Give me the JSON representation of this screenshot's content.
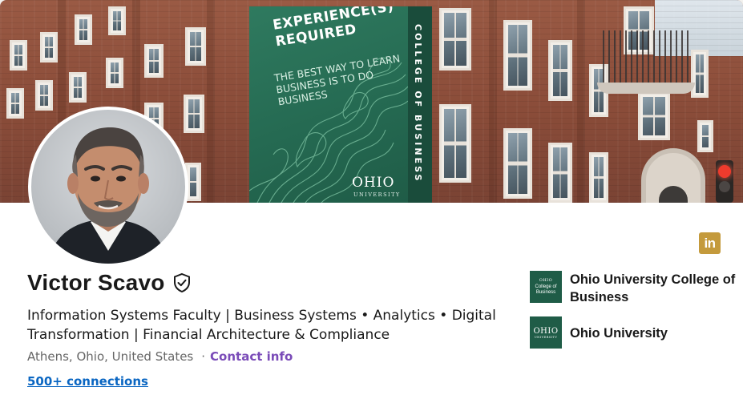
{
  "banner": {
    "headline": "EXPERIENCE(S) REQUIRED",
    "subtext": "THE BEST WAY TO LEARN BUSINESS IS TO DO BUSINESS",
    "vertical_text": "COLLEGE OF BUSINESS",
    "logo_main": "OHIO",
    "logo_sub": "UNIVERSITY"
  },
  "profile": {
    "name": "Victor Scavo",
    "headline": "Information Systems Faculty | Business Systems • Analytics • Digital Transformation | Financial Architecture & Compliance",
    "location": "Athens, Ohio, United States",
    "separator": "·",
    "contact_label": "Contact info",
    "connections": "500+ connections"
  },
  "social_icon": {
    "label": "in",
    "icon": "linkedin-icon",
    "color": "#c49a3c"
  },
  "organizations": [
    {
      "name": "Ohio University College of Business",
      "logo_line1": "OHIO",
      "logo_line2": "College of Business",
      "logo_color": "#1f5c47"
    },
    {
      "name": "Ohio University",
      "logo_line1": "OHIO",
      "logo_line2": "UNIVERSITY",
      "logo_color": "#1f5c47"
    }
  ],
  "colors": {
    "link_blue": "#0a66c2",
    "contact_purple": "#7a4bb8",
    "text_primary": "#191919",
    "text_secondary": "#666666"
  }
}
